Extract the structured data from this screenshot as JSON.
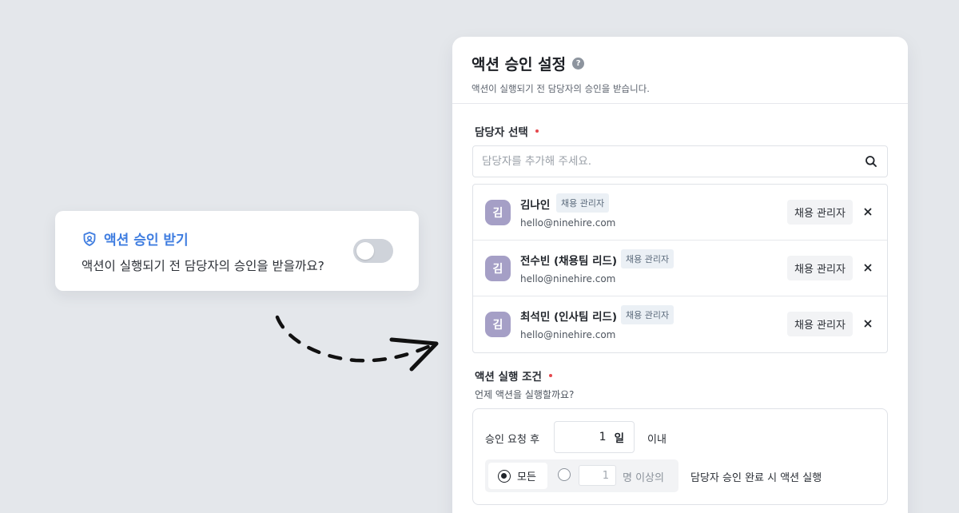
{
  "toggle_card": {
    "title": "액션 승인 받기",
    "question": "액션이 실행되기 전 담당자의 승인을 받을까요?",
    "enabled": false
  },
  "panel": {
    "title": "액션 승인 설정",
    "help_icon_label": "?",
    "subtitle": "액션이 실행되기 전 담당자의 승인을 받습니다.",
    "assignee_section_label": "담당자 선택",
    "search_placeholder": "담당자를 추가해 주세요.",
    "assignees": [
      {
        "avatar": "김",
        "name": "김나인",
        "tag": "채용 관리자",
        "email": "hello@ninehire.com",
        "role": "채용 관리자"
      },
      {
        "avatar": "김",
        "name": "전수빈 (채용팀 리드)",
        "tag": "채용 관리자",
        "email": "hello@ninehire.com",
        "role": "채용 관리자"
      },
      {
        "avatar": "김",
        "name": "최석민 (인사팀 리드)",
        "tag": "채용 관리자",
        "email": "hello@ninehire.com",
        "role": "채용 관리자"
      }
    ],
    "condition": {
      "label": "액션 실행 조건",
      "help": "언제 액션을 실행할까요?",
      "after_request_label": "승인 요청 후",
      "days_value": "1",
      "days_unit": "일",
      "within_label": "이내",
      "option_all": "모든",
      "min_count_value": "1",
      "min_count_suffix": "명 이상의",
      "tail_text": "담당자 승인 완료 시 액션 실행",
      "selected_option": "모든"
    }
  },
  "colors": {
    "accent": "#3f7de0",
    "required_dot": "#e5484d",
    "avatar_bg": "#a59fc6",
    "background": "#e4e7eb"
  }
}
